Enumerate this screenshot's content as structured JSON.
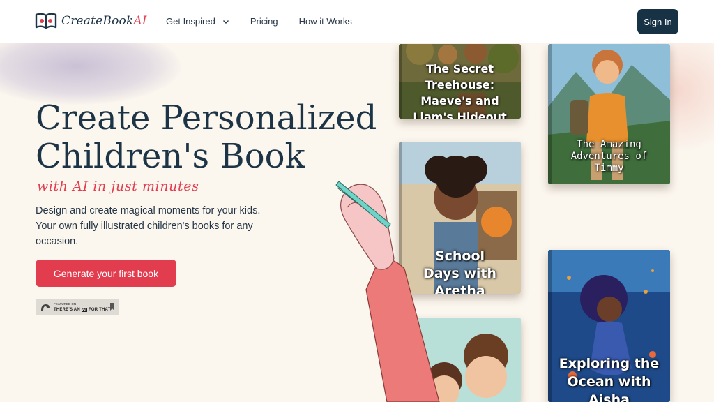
{
  "brand": {
    "name": "CreateBook",
    "accent": "AI",
    "accent_color": "#e23d4f",
    "primary_color": "#163244"
  },
  "nav": [
    {
      "label": "Get Inspired",
      "has_dropdown": true,
      "icon": "chevron-down-icon"
    },
    {
      "label": "Pricing"
    },
    {
      "label": "How it Works"
    }
  ],
  "auth": {
    "signin_label": "Sign In"
  },
  "hero": {
    "title_line1": "Create Personalized",
    "title_line2": "Children's Book",
    "tagline": "with AI in just minutes",
    "description": "Design and create magical moments for your kids. Your own  fully illustrated children's books for any occasion.",
    "cta_label": "Generate your first book"
  },
  "badge": {
    "small": "FEATURED ON",
    "main_pre": "THERE'S AN ",
    "main_ai": "AI",
    "main_post": " FOR THAT",
    "icon": "bookmark-icon"
  },
  "books": [
    {
      "title": "The Secret Treehouse: Maeve's and Liam's Hideout"
    },
    {
      "title": "The Amazing Adventures of Timmy"
    },
    {
      "title": "School Days with Aretha"
    },
    {
      "title": ""
    },
    {
      "title": "Exploring the Ocean with Aisha"
    }
  ]
}
